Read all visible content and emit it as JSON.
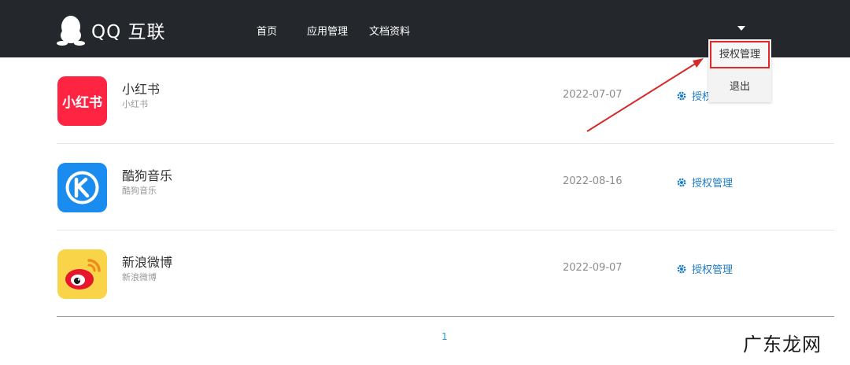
{
  "header": {
    "logo_text": "QQ 互联",
    "nav": [
      "首页",
      "应用管理",
      "文档资料"
    ]
  },
  "dropdown": {
    "items": [
      "授权管理",
      "退出"
    ]
  },
  "apps": [
    {
      "name": "小红书",
      "sub": "小红书",
      "date": "2022-07-07",
      "action": "授权管理",
      "icon": "xiaohongshu-icon"
    },
    {
      "name": "酷狗音乐",
      "sub": "酷狗音乐",
      "date": "2022-08-16",
      "action": "授权管理",
      "icon": "kugou-icon"
    },
    {
      "name": "新浪微博",
      "sub": "新浪微博",
      "date": "2022-09-07",
      "action": "授权管理",
      "icon": "weibo-icon"
    }
  ],
  "pagination": {
    "current": "1"
  },
  "watermark": "广东龙网",
  "icons": {
    "xiaohongshu_text": "小红书"
  },
  "colors": {
    "header_bg": "#24272c",
    "link": "#1f7cc4",
    "highlight_border": "#e0292b",
    "xiaohongshu": "#ff2442",
    "kugou": "#1a8cf0",
    "weibo_bg": "#f9d448"
  }
}
